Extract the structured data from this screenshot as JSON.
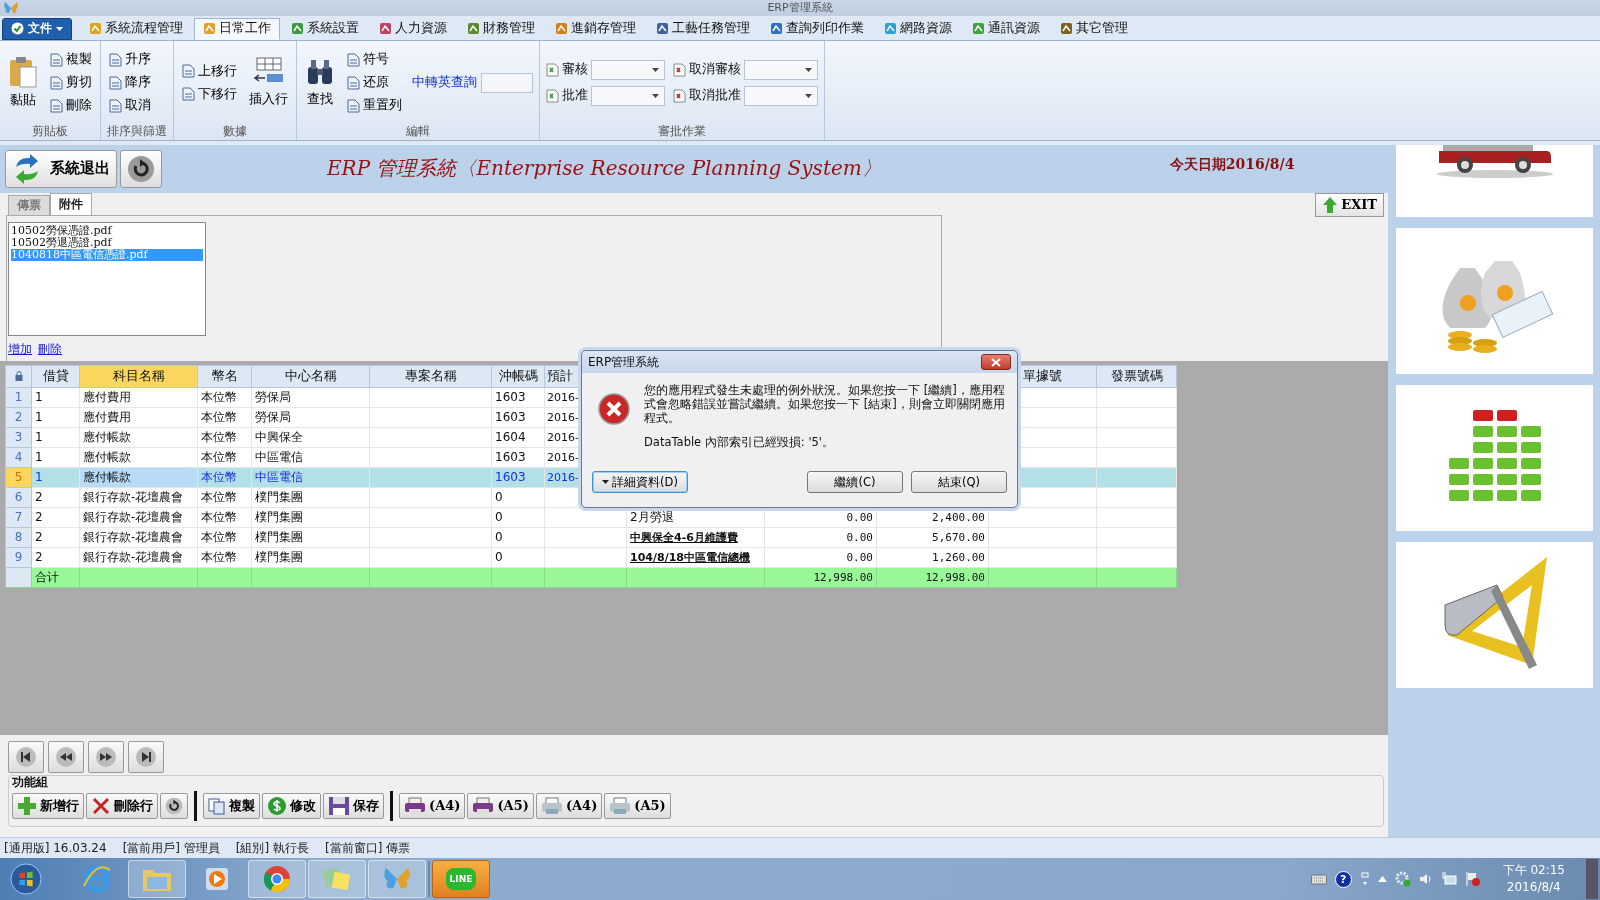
{
  "window": {
    "title": "ERP管理系統"
  },
  "menu": {
    "file_menu": "文件",
    "tabs": [
      {
        "label": "系統流程管理",
        "selected": false
      },
      {
        "label": "日常工作",
        "selected": true
      },
      {
        "label": "系統設置",
        "selected": false
      },
      {
        "label": "人力資源",
        "selected": false
      },
      {
        "label": "財務管理",
        "selected": false
      },
      {
        "label": "進銷存管理",
        "selected": false
      },
      {
        "label": "工藝任務管理",
        "selected": false
      },
      {
        "label": "查詢列印作業",
        "selected": false
      },
      {
        "label": "網路資源",
        "selected": false
      },
      {
        "label": "通訊資源",
        "selected": false
      },
      {
        "label": "其它管理",
        "selected": false
      }
    ]
  },
  "ribbon": {
    "groups": [
      {
        "label": "剪貼板",
        "columns": [
          [
            {
              "label": "黏貼",
              "kind": "large"
            }
          ],
          [
            {
              "label": "複製",
              "kind": "small"
            },
            {
              "label": "剪切",
              "kind": "small"
            },
            {
              "label": "刪除",
              "kind": "small"
            }
          ]
        ]
      },
      {
        "label": "排序與篩選",
        "columns": [
          [
            {
              "label": "升序",
              "kind": "small"
            },
            {
              "label": "降序",
              "kind": "small"
            },
            {
              "label": "取消",
              "kind": "small"
            }
          ]
        ]
      },
      {
        "label": "數據",
        "columns": [
          [
            {
              "label": "上移行",
              "kind": "small"
            },
            {
              "label": "下移行",
              "kind": "small"
            }
          ],
          [
            {
              "label": "插入行",
              "kind": "large"
            }
          ]
        ]
      },
      {
        "label": "編輯",
        "columns": [
          [
            {
              "label": "查找",
              "kind": "large"
            }
          ],
          [
            {
              "label": "符号",
              "kind": "small"
            },
            {
              "label": "还原",
              "kind": "small"
            },
            {
              "label": "重置列",
              "kind": "small"
            }
          ],
          [
            {
              "label": "中轉英查詢",
              "kind": "lookup"
            }
          ]
        ]
      },
      {
        "label": "審批作業",
        "columns": [
          [
            {
              "label": "審核",
              "kind": "dropdown"
            },
            {
              "label": "批准",
              "kind": "dropdown"
            }
          ],
          [
            {
              "label": "取消審核",
              "kind": "dropdown"
            },
            {
              "label": "取消批准",
              "kind": "dropdown"
            }
          ]
        ]
      }
    ]
  },
  "header": {
    "exit_button": "系統退出",
    "title": "ERP 管理系統〈Enterprise Resource Planning System〉",
    "date": "今天日期2016/8/4",
    "close_button": "EXIT"
  },
  "form_tabs": [
    {
      "label": "傳票",
      "selected": false
    },
    {
      "label": "附件",
      "selected": true
    }
  ],
  "attachments": {
    "files": [
      {
        "name": "10502勞保憑證.pdf",
        "selected": false
      },
      {
        "name": "10502勞退憑證.pdf",
        "selected": false
      },
      {
        "name": "1040818中區電信憑證.pdf",
        "selected": true
      }
    ],
    "links": [
      "增加",
      "刪除"
    ]
  },
  "table": {
    "columns": [
      {
        "label": "借貸",
        "selected": false
      },
      {
        "label": "科目名稱",
        "selected": true
      },
      {
        "label": "幣名",
        "selected": false
      },
      {
        "label": "中心名稱",
        "selected": false
      },
      {
        "label": "專案名稱",
        "selected": false
      },
      {
        "label": "沖帳碼",
        "selected": false
      },
      {
        "label": "預計",
        "selected": false
      },
      {},
      {},
      {},
      {
        "label": "單據號",
        "selected": false
      },
      {
        "label": "發票號碼",
        "selected": false
      }
    ],
    "rows": [
      {
        "number": "1",
        "selected": false,
        "debit_credit": "1",
        "account": "應付費用",
        "currency": "本位幣",
        "center": "勞保局",
        "offset_code": "1603",
        "column_7": "2016-"
      },
      {
        "number": "2",
        "selected": false,
        "debit_credit": "1",
        "account": "應付費用",
        "currency": "本位幣",
        "center": "勞保局",
        "offset_code": "1603",
        "column_7": "2016-"
      },
      {
        "number": "3",
        "selected": false,
        "debit_credit": "1",
        "account": "應付帳款",
        "currency": "本位幣",
        "center": "中興保全",
        "offset_code": "1604",
        "column_7": "2016-"
      },
      {
        "number": "4",
        "selected": false,
        "debit_credit": "1",
        "account": "應付帳款",
        "currency": "本位幣",
        "center": "中區電信",
        "offset_code": "1603",
        "column_7": "2016-"
      },
      {
        "number": "5",
        "selected": true,
        "debit_credit": "1",
        "account": "應付帳款",
        "currency": "本位幣",
        "center": "中區電信",
        "offset_code": "1603",
        "column_7": "2016-"
      },
      {
        "number": "6",
        "selected": false,
        "debit_credit": "2",
        "account": "銀行存款-花壇農會",
        "currency": "本位幣",
        "center": "樸門集團",
        "offset_code": "0"
      },
      {
        "number": "7",
        "selected": false,
        "debit_credit": "2",
        "account": "銀行存款-花壇農會",
        "currency": "本位幣",
        "center": "樸門集團",
        "offset_code": "0",
        "summary": "2月勞退",
        "emphasized": false,
        "debit": "0.00",
        "credit": "2,400.00"
      },
      {
        "number": "8",
        "selected": false,
        "debit_credit": "2",
        "account": "銀行存款-花壇農會",
        "currency": "本位幣",
        "center": "樸門集團",
        "offset_code": "0",
        "summary": "中興保全4-6月維護費",
        "emphasized": true,
        "debit": "0.00",
        "credit": "5,670.00"
      },
      {
        "number": "9",
        "selected": false,
        "debit_credit": "2",
        "account": "銀行存款-花壇農會",
        "currency": "本位幣",
        "center": "樸門集團",
        "offset_code": "0",
        "summary": "104/8/18中區電信總機",
        "emphasized": true,
        "debit": "0.00",
        "credit": "1,260.00"
      }
    ],
    "total": {
      "label": "合计",
      "debit": "12,998.00",
      "credit": "12,998.00"
    }
  },
  "toolbar": {
    "label": "功能組",
    "groups": [
      [
        {
          "label": "新增行"
        },
        {
          "label": "刪除行"
        }
      ],
      [
        {
          "label": "複製"
        },
        {
          "label": "修改"
        },
        {
          "label": "保存"
        }
      ],
      [
        {
          "label": "(A4)"
        },
        {
          "label": "(A5)"
        },
        {
          "label": "(A4)"
        },
        {
          "label": "(A5)"
        }
      ]
    ]
  },
  "status_bar": [
    "[通用版] 16.03.24",
    "[當前用戶] 管理員",
    "[組別] 執行長",
    "[當前窗口] 傳票"
  ],
  "taskbar": {
    "line_label": "LINE",
    "help_label": "?",
    "time": "下午 02:15",
    "date": "2016/8/4"
  },
  "dialog": {
    "title": "ERP管理系統",
    "message": "您的應用程式發生未處理的例外狀況。如果您按一下 [繼續]，應用程式會忽略錯誤並嘗試繼續。如果您按一下 [結束]，則會立即關閉應用程式。",
    "detail": "DataTable 內部索引已經毀損: '5'。",
    "buttons": [
      {
        "label": "詳細資料(D)",
        "focused": true
      },
      {
        "label": "繼續(C)",
        "focused": false
      },
      {
        "label": "結束(Q)",
        "focused": false
      }
    ]
  }
}
